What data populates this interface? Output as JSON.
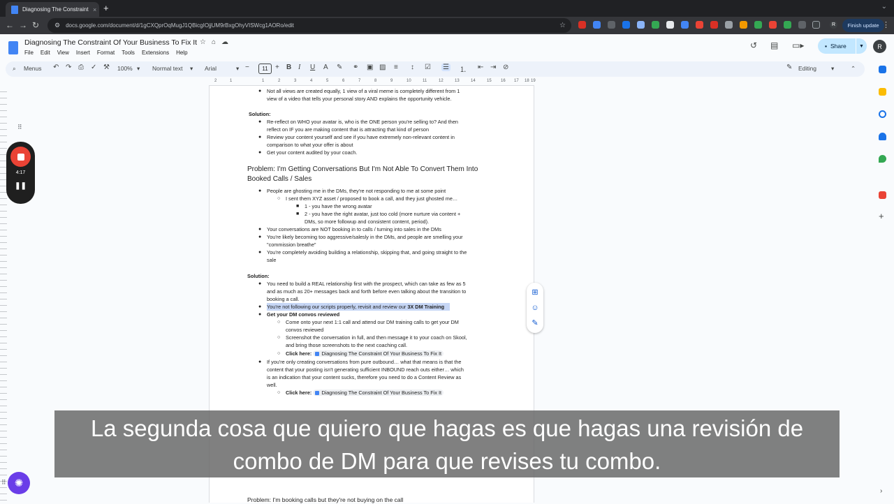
{
  "browser": {
    "tab_title": "Diagnosing The Constraint Of",
    "tab_close": "×",
    "new_tab": "+",
    "url": "docs.google.com/document/d/1gCXQprOqMugJ1QBicgIOjjUM9rBxgOhyVISWcg1AORo/edit",
    "finish_update": "Finish update",
    "profile_initial": "R"
  },
  "docs": {
    "title": "Diagnosing The Constraint Of Your Business To Fix It",
    "menus": [
      "File",
      "Edit",
      "View",
      "Insert",
      "Format",
      "Tools",
      "Extensions",
      "Help"
    ],
    "share_label": "Share",
    "avatar_initial": "R"
  },
  "toolbar": {
    "menus_label": "Menus",
    "zoom": "100%",
    "style": "Normal text",
    "font": "Arial",
    "font_size": "11",
    "bold": "B",
    "italic": "I",
    "underline": "U",
    "text_color": "A",
    "editing_mode": "Editing"
  },
  "ruler": {
    "numbers": [
      "2",
      "1",
      "1",
      "2",
      "3",
      "4",
      "5",
      "6",
      "7",
      "8",
      "9",
      "10",
      "11",
      "12",
      "13",
      "14",
      "15",
      "16",
      "17",
      "18",
      "19"
    ]
  },
  "document": {
    "l1": "Not all views are created equally, 1 view of a viral meme is completely different from 1",
    "l2": "view of a video that tells your personal story AND explains the opportunity vehicle.",
    "solution1": "Solution:",
    "l3": "Re-reflect on WHO your avatar is, who is the ONE person you're selling to? And then",
    "l4": "reflect on IF you are making content that is attracting that kind of person",
    "l5": "Review your content yourself and see if you have extremely non-relevant content in",
    "l6": "comparison to what your offer is about",
    "l7": "Get your content audited by your coach.",
    "heading1a": "Problem: I'm Getting Conversations But I'm Not Able To Convert Them Into",
    "heading1b": "Booked Calls / Sales",
    "p1": "People are ghosting me in the DMs, they're not responding to me at some point",
    "p2": "I sent them XYZ asset / proposed to book a call, and they just ghosted me…",
    "p3": "1 - you have the wrong avatar",
    "p4": "2 - you have the right avatar, just too cold (more nurture via content +",
    "p5": "DMs, so more followup and consistent content, period).",
    "p6": "Your conversations are NOT booking in to calls / turning into sales in the DMs",
    "p7": "You're likely becoming too aggressive/salesly in the DMs, and people are smelling your",
    "p8": "\"commission breathe\"",
    "p9": "You're completely avoiding building a relationship, skipping that, and going straight to the",
    "p10": "sale",
    "solution2": "Solution:",
    "s1": "You need to build a REAL relationship first with the prospect, which can take as few as 5",
    "s2": "and as much as 20+ messages back and forth before even talking about the transition to",
    "s3": "booking a call.",
    "s4a": "You're not following our scripts properly, revisit and review our ",
    "s4b": "3X DM Training",
    "s5": "Get your DM convos reviewed",
    "s6": "Come onto your next 1:1 call and attend our DM training calls to get your DM",
    "s7": "convos reviewed",
    "s8": "Screenshot the conversation in full, and then message it to your coach on Skool,",
    "s9": "and bring those screenshots to the next coaching call.",
    "click_here_1": "Click here:",
    "chip_1": "Diagnosing The Constraint Of Your Business To Fix It",
    "s10": "If you're only creating conversations from pure outbound… what that means is that the",
    "s11": "content that your posting isn't generating sufficient INBOUND reach outs either… which",
    "s12": "is an indication that your content sucks, therefore you need to do a Content Review as",
    "s13": "well.",
    "click_here_2": "Click here:",
    "chip_2": "Diagnosing The Constraint Of Your Business To Fix It",
    "heading2": "Problem: I'm booking calls but they're not buying on the call"
  },
  "recorder": {
    "time": "4:17",
    "pause": "❚❚"
  },
  "subtitles": {
    "line1": "La segunda cosa que quiero que hagas es que hagas una revisión de",
    "line2": "combo de DM para que revises tu combo."
  },
  "colors": {
    "accent": "#0b57d0",
    "share_bg": "#c2e7ff",
    "record_red": "#ea4335",
    "highlight": "#c6d6f5"
  }
}
